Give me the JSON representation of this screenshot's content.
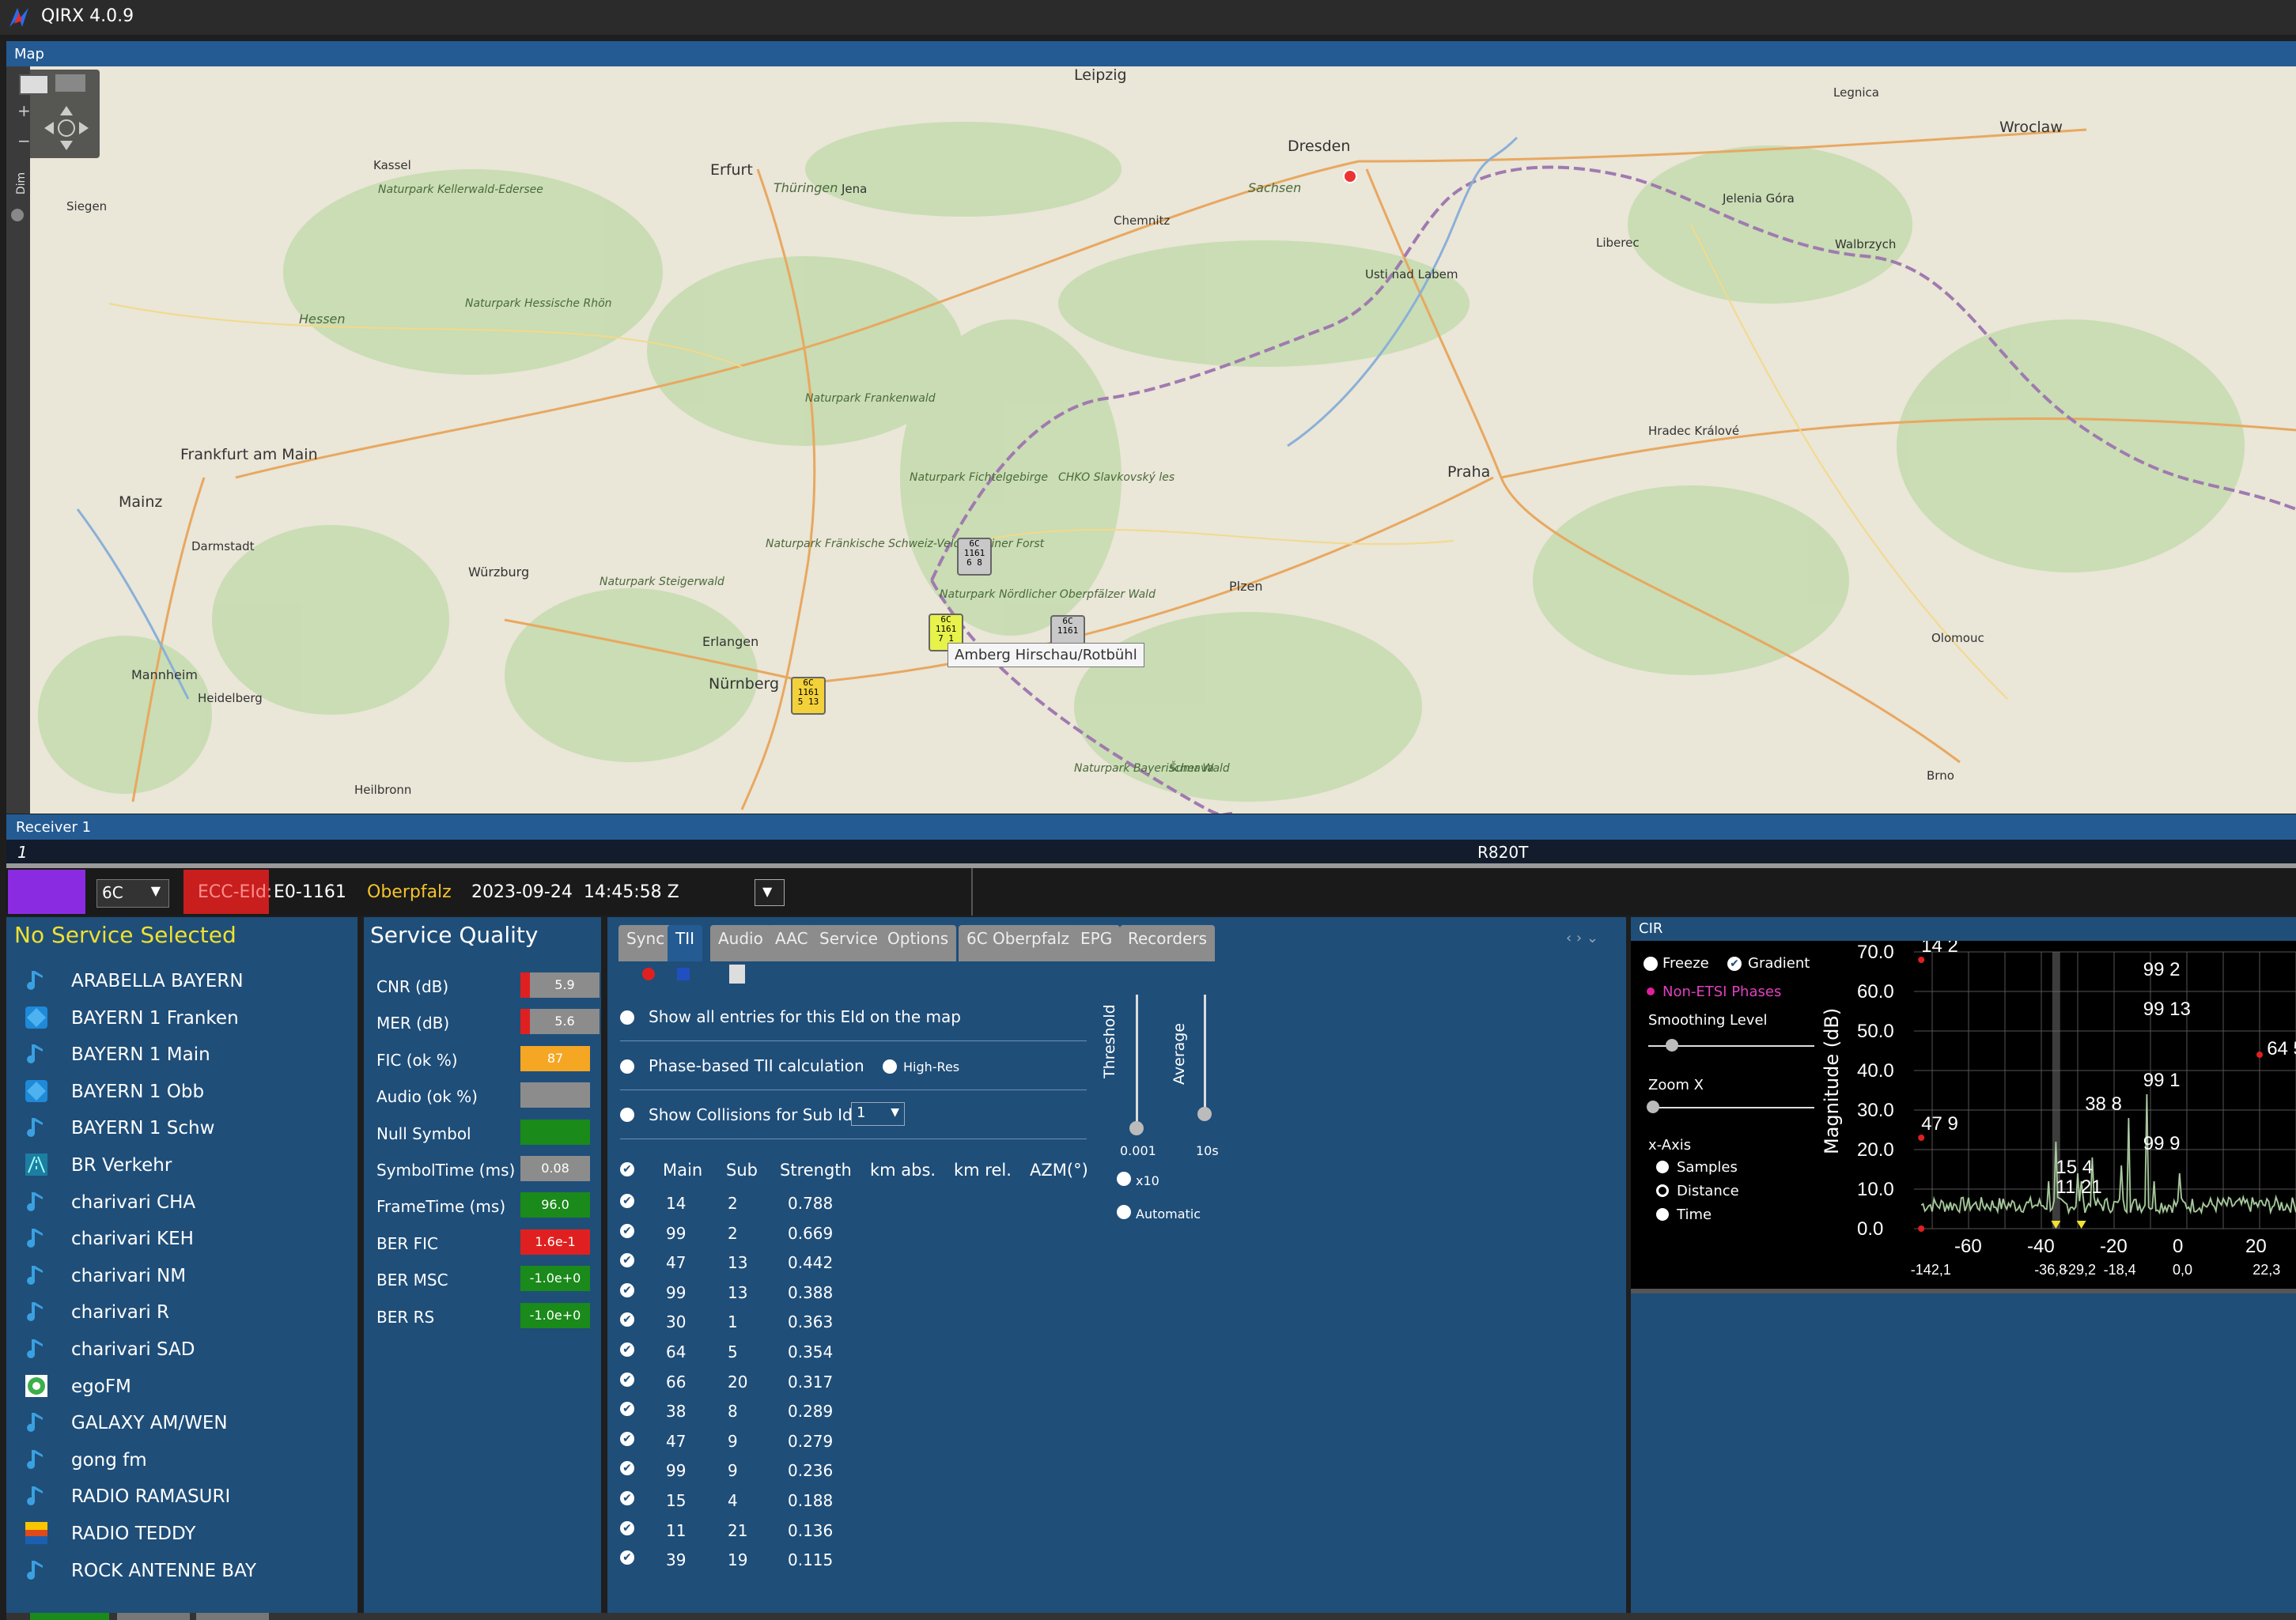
{
  "app": {
    "title": "QIRX 4.0.9"
  },
  "map": {
    "header": "Map",
    "dim_label": "Dim",
    "tooltip": "Amberg Hirschau/Rotbühl",
    "cities": [
      "Dresden",
      "Erfurt",
      "Leipzig",
      "Chemnitz",
      "Wroclaw",
      "Legnica",
      "Frankfurt am Main",
      "Mainz",
      "Darmstadt",
      "Würzburg",
      "Erlangen",
      "Nürnberg",
      "Plzen",
      "Praha",
      "Hradec Králové",
      "Liberec",
      "Mannheim",
      "Heidelberg",
      "Heilbronn",
      "Siegen",
      "Kassel",
      "Walbrzych",
      "Jelenia Góra",
      "Usti nad Labem",
      "Olomouc",
      "Brno",
      "Jena",
      "Hessen",
      "Thüringen",
      "Sachsen"
    ],
    "parks": [
      "Naturpark Kellerwald-Edersee",
      "Naturpark Hessische Rhön",
      "Naturpark Frankenwald",
      "Naturpark Fichtelgebirge",
      "Naturpark Fränkische Schweiz-Veldensteiner Forst",
      "Naturpark Steigerwald",
      "Naturpark Nördlicher Oberpfälzer Wald",
      "Naturpark Bayerischer Wald",
      "CHKO Slavkovský les",
      "Šumava"
    ],
    "pins": [
      {
        "line1": "6C",
        "line2": "1161",
        "line3": "6 8",
        "color": "grey"
      },
      {
        "line1": "6C",
        "line2": "1161",
        "line3": "7 1",
        "color": "lime"
      },
      {
        "line1": "6C",
        "line2": "1161",
        "line3": "",
        "color": "grey"
      },
      {
        "line1": "6C",
        "line2": "1161",
        "line3": "5 13",
        "color": "yellow"
      }
    ]
  },
  "receiver": {
    "header": "Receiver 1",
    "number": "1",
    "tuner": "R820T",
    "channel": "6C",
    "ecc_label": "ECC-EId:",
    "eid": "E0-1161",
    "ensemble": "Oberpfalz",
    "datetime": "2023-09-24  14:45:58 Z"
  },
  "services": {
    "header": "No Service Selected",
    "items": [
      {
        "label": "ARABELLA BAYERN",
        "icon": "music-note-icon"
      },
      {
        "label": "BAYERN 1 Franken",
        "icon": "br-logo-icon"
      },
      {
        "label": "BAYERN 1 Main",
        "icon": "music-note-icon"
      },
      {
        "label": "BAYERN 1 Obb",
        "icon": "br-logo-icon"
      },
      {
        "label": "BAYERN 1 Schw",
        "icon": "music-note-icon"
      },
      {
        "label": "BR Verkehr",
        "icon": "traffic-icon"
      },
      {
        "label": "charivari CHA",
        "icon": "music-note-icon"
      },
      {
        "label": "charivari KEH",
        "icon": "music-note-icon"
      },
      {
        "label": "charivari NM",
        "icon": "music-note-icon"
      },
      {
        "label": "charivari R",
        "icon": "music-note-icon"
      },
      {
        "label": "charivari SAD",
        "icon": "music-note-icon"
      },
      {
        "label": "egoFM",
        "icon": "egofm-logo-icon"
      },
      {
        "label": "GALAXY AM/WEN",
        "icon": "music-note-icon"
      },
      {
        "label": "gong fm",
        "icon": "music-note-icon"
      },
      {
        "label": "RADIO RAMASURI",
        "icon": "music-note-icon"
      },
      {
        "label": "RADIO TEDDY",
        "icon": "radio-teddy-logo-icon"
      },
      {
        "label": "ROCK ANTENNE BAY",
        "icon": "music-note-icon"
      }
    ]
  },
  "quality": {
    "title": "Service Quality",
    "rows": [
      {
        "label": "CNR (dB)",
        "value": "5.9",
        "color": "#8c8c8c",
        "marker": "#e02020"
      },
      {
        "label": "MER (dB)",
        "value": "5.6",
        "color": "#8c8c8c",
        "marker": "#e02020"
      },
      {
        "label": "FIC (ok %)",
        "value": "87",
        "color": "#f5a623",
        "marker": ""
      },
      {
        "label": "Audio (ok %)",
        "value": "",
        "color": "#8c8c8c",
        "marker": ""
      },
      {
        "label": "Null Symbol",
        "value": "",
        "color": "#1a8a1a",
        "marker": ""
      },
      {
        "label": "SymbolTime (ms)",
        "value": "0.08",
        "color": "#8c8c8c",
        "marker": ""
      },
      {
        "label": "FrameTime (ms)",
        "value": "96.0",
        "color": "#1a8a1a",
        "marker": ""
      },
      {
        "label": "BER FIC",
        "value": "1.6e-1",
        "color": "#e02020",
        "marker": ""
      },
      {
        "label": "BER MSC",
        "value": "-1.0e+0",
        "color": "#1a8a1a",
        "marker": ""
      },
      {
        "label": "BER RS",
        "value": "-1.0e+0",
        "color": "#1a8a1a",
        "marker": ""
      }
    ]
  },
  "tii": {
    "tabs": [
      "Sync",
      "TII",
      "Audio",
      "AAC",
      "Service",
      "Options",
      "6C Oberpfalz",
      "EPG",
      "Recorders"
    ],
    "active_tab": "TII",
    "option_show_all": "Show all entries for this EId on the map",
    "option_phase": "Phase-based TII calculation",
    "option_highres": "High-Res",
    "option_collisions": "Show Collisions for Sub Id",
    "collisions_value": "1",
    "threshold_label": "Threshold",
    "threshold_value": "0.001",
    "average_label": "Average",
    "average_value": "10s",
    "x10_label": "x10",
    "automatic_label": "Automatic",
    "columns": [
      "Main",
      "Sub",
      "Strength",
      "km abs.",
      "km rel.",
      "AZM(°)"
    ],
    "rows": [
      {
        "main": "14",
        "sub": "2",
        "strength": "0.788"
      },
      {
        "main": "99",
        "sub": "2",
        "strength": "0.669"
      },
      {
        "main": "47",
        "sub": "13",
        "strength": "0.442"
      },
      {
        "main": "99",
        "sub": "13",
        "strength": "0.388"
      },
      {
        "main": "30",
        "sub": "1",
        "strength": "0.363"
      },
      {
        "main": "64",
        "sub": "5",
        "strength": "0.354"
      },
      {
        "main": "66",
        "sub": "20",
        "strength": "0.317"
      },
      {
        "main": "38",
        "sub": "8",
        "strength": "0.289"
      },
      {
        "main": "47",
        "sub": "9",
        "strength": "0.279"
      },
      {
        "main": "99",
        "sub": "9",
        "strength": "0.236"
      },
      {
        "main": "15",
        "sub": "4",
        "strength": "0.188"
      },
      {
        "main": "11",
        "sub": "21",
        "strength": "0.136"
      },
      {
        "main": "39",
        "sub": "19",
        "strength": "0.115"
      }
    ]
  },
  "cir": {
    "header": "CIR",
    "freeze": "Freeze",
    "gradient": "Gradient",
    "non_etsi": "Non-ETSI Phases",
    "smoothing": "Smoothing Level",
    "zoom": "Zoom X",
    "x_axis": "x-Axis",
    "x_options": [
      "Samples",
      "Distance",
      "Time"
    ],
    "selected_x": "Distance",
    "chart_data": {
      "type": "line",
      "ylabel": "Magnitude (dB)",
      "y_ticks": [
        "70.0",
        "60.0",
        "50.0",
        "40.0",
        "30.0",
        "20.0",
        "10.0",
        "0.0"
      ],
      "x_ticks": [
        "-60",
        "-40",
        "-20",
        "0",
        "20"
      ],
      "x_extra_labels": [
        "-142,1",
        "-36,8",
        "-29,2",
        "-18,4",
        "0,0",
        "22,3"
      ],
      "ylim": [
        0,
        70
      ],
      "xlim": [
        -75,
        30
      ],
      "peak_labels": [
        "14 2",
        "99 2",
        "99 13",
        "64 5",
        "99 1",
        "38 8",
        "47 9",
        "99 9",
        "15 4",
        "11 21"
      ]
    }
  }
}
